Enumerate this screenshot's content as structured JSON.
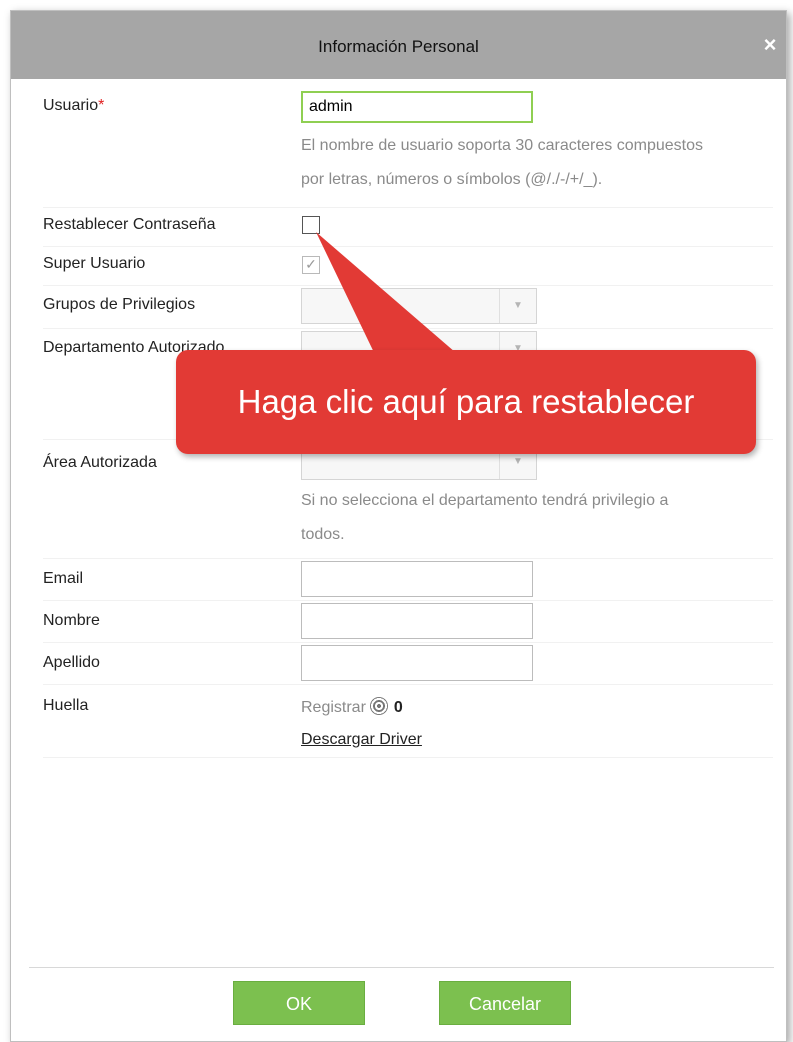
{
  "dialog": {
    "title": "Información Personal",
    "close_glyph": "×"
  },
  "fields": {
    "usuario": {
      "label": "Usuario",
      "required_mark": "*",
      "value": "admin",
      "hint_line1": "El nombre de usuario soporta 30 caracteres compuestos",
      "hint_line2": "por letras, números o símbolos (@/./-/+/_)."
    },
    "restablecer": {
      "label": "Restablecer Contraseña",
      "checked": false
    },
    "super_usuario": {
      "label": "Super Usuario",
      "checked": true,
      "check_glyph": "✓"
    },
    "grupos": {
      "label": "Grupos de Privilegios",
      "value": ""
    },
    "departamento": {
      "label": "Departamento Autorizado",
      "value": ""
    },
    "area": {
      "label": "Área Autorizada",
      "value": "",
      "hint_line1": "Si no selecciona el departamento tendrá privilegio a",
      "hint_line2": "todos."
    },
    "email": {
      "label": "Email",
      "value": ""
    },
    "nombre": {
      "label": "Nombre",
      "value": ""
    },
    "apellido": {
      "label": "Apellido",
      "value": ""
    },
    "huella": {
      "label": "Huella",
      "register_text": "Registrar",
      "count": "0",
      "driver_link": "Descargar Driver"
    }
  },
  "callout": {
    "text": "Haga clic aquí para restablecer"
  },
  "buttons": {
    "ok": "OK",
    "cancel": "Cancelar"
  },
  "colors": {
    "titlebar": "#a6a6a6",
    "button_green": "#7cc04f",
    "callout_red": "#e23a35",
    "required_red": "#e02020",
    "active_input_border": "#8fcf52"
  },
  "icons": {
    "close": "close-icon",
    "fingerprint": "fingerprint-icon",
    "dropdown": "chevron-down-icon",
    "check": "checkmark-icon"
  }
}
